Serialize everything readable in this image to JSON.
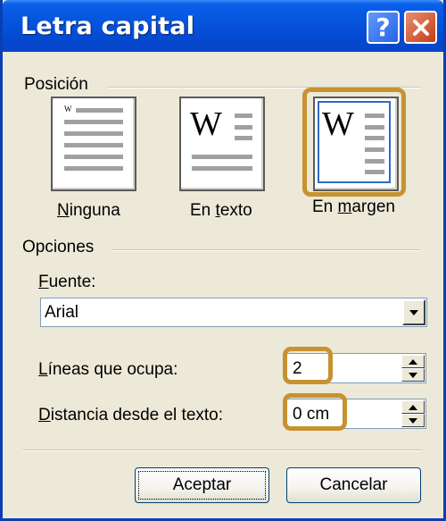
{
  "window": {
    "title": "Letra capital"
  },
  "titlebar": {
    "help_glyph": "?"
  },
  "position_group": {
    "label": "Posición",
    "options": [
      {
        "label_before": "",
        "label_accel": "N",
        "label_after": "inguna",
        "preview_letter": "W",
        "selected": false
      },
      {
        "label_before": "En ",
        "label_accel": "t",
        "label_after": "exto",
        "preview_letter": "W",
        "selected": false
      },
      {
        "label_before": "En ",
        "label_accel": "m",
        "label_after": "argen",
        "preview_letter": "W",
        "selected": true
      }
    ]
  },
  "options_group": {
    "label": "Opciones",
    "font_label_accel": "F",
    "font_label_rest": "uente:",
    "font_value": "Arial",
    "lines_label_accel": "L",
    "lines_label_rest": "íneas que ocupa:",
    "lines_value": "2",
    "distance_label_accel": "D",
    "distance_label_rest": "istancia desde el texto:",
    "distance_value": "0 cm"
  },
  "buttons": {
    "ok": "Aceptar",
    "cancel": "Cancelar"
  },
  "colors": {
    "highlight": "#c8922f",
    "titlebar": "#0653dc",
    "selection": "#316ac5"
  }
}
